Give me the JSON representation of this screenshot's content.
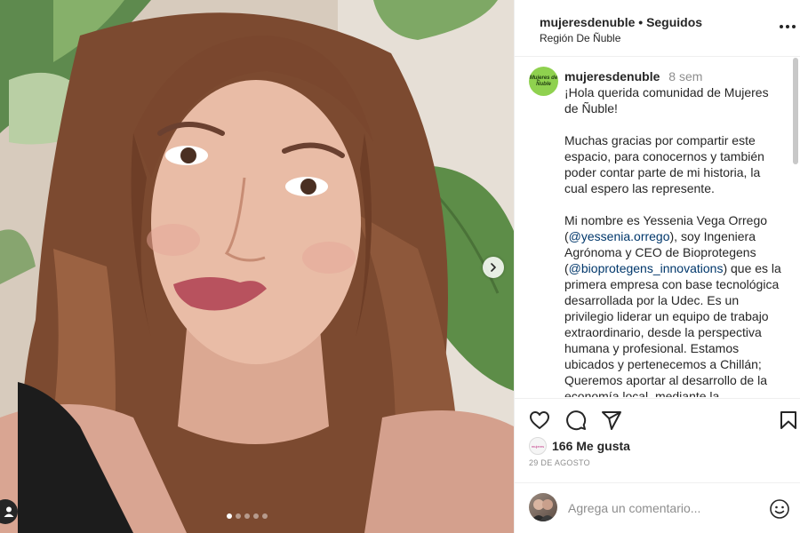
{
  "post": {
    "username": "mujeresdenuble",
    "separator": "•",
    "follow_status": "Seguidos",
    "location": "Región De Ñuble"
  },
  "caption": {
    "avatar_text": "Mujeres de Ñuble",
    "username": "mujeresdenuble",
    "time": "8 sem",
    "line1": "¡Hola querida comunidad de Mujeres de Ñuble!",
    "para2": "Muchas gracias por compartir este espacio, para conocernos y también poder contar parte de mi historia, la cual espero las represente.",
    "para3_a": "Mi nombre es Yessenia Vega Orrego (",
    "mention1": "@yessenia.orrego",
    "para3_b": "), soy Ingeniera Agrónoma y CEO de Bioprotegens (",
    "mention2": "@bioprotegens_innovations",
    "para3_c": ") que es la primera empresa con base tecnológica desarrollada por la Udec. Es un privilegio liderar un equipo de trabajo extraordinario, desde la perspectiva humana y profesional. Estamos ubicados y pertenecemos a Chillán; Queremos aportar al desarrollo de la economía local, mediante la"
  },
  "media": {
    "slide_count": 5,
    "active_slide": 1
  },
  "actions": {
    "likes": "166 Me gusta",
    "likes_avatar_text": "mujeres",
    "date": "29 DE AGOSTO"
  },
  "comment_box": {
    "placeholder": "Agrega un comentario..."
  },
  "icons": {
    "like": "heart-icon",
    "comment": "comment-icon",
    "share": "share-icon",
    "save": "bookmark-icon",
    "emoji": "emoji-icon",
    "next": "chevron-right-icon",
    "tagged": "user-icon",
    "more": "more-options-icon"
  }
}
